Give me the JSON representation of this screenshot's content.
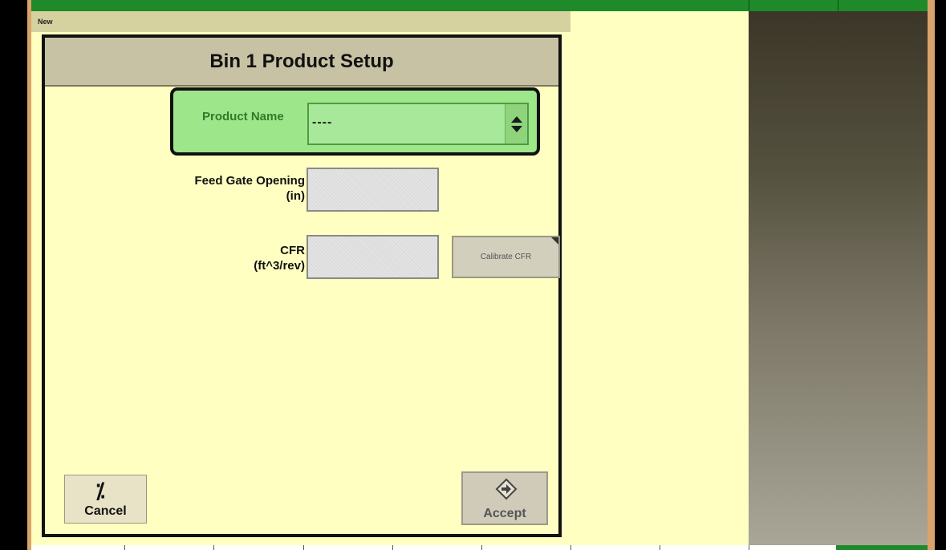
{
  "header_strip": {
    "label": "New"
  },
  "dialog": {
    "title": "Bin 1 Product Setup",
    "product_name": {
      "label": "Product Name",
      "value": "----"
    },
    "feed_gate": {
      "label_line1": "Feed Gate Opening",
      "label_line2": "(in)",
      "value": ""
    },
    "cfr": {
      "label_line1": "CFR",
      "label_line2": "(ft^3/rev)",
      "value": ""
    },
    "calibrate_button": "Calibrate CFR",
    "cancel_button": "Cancel",
    "accept_button": "Accept"
  },
  "icons": {
    "spinner": "up-down-spinner-icon",
    "cancel": "cancel-slash-icon",
    "accept": "accept-diamond-arrow-icon"
  },
  "colors": {
    "top_bar": "#1f8a2a",
    "panel_yellow": "#ffffc2",
    "highlight_green": "#9ee68a",
    "header_tan": "#c8c2a4"
  }
}
